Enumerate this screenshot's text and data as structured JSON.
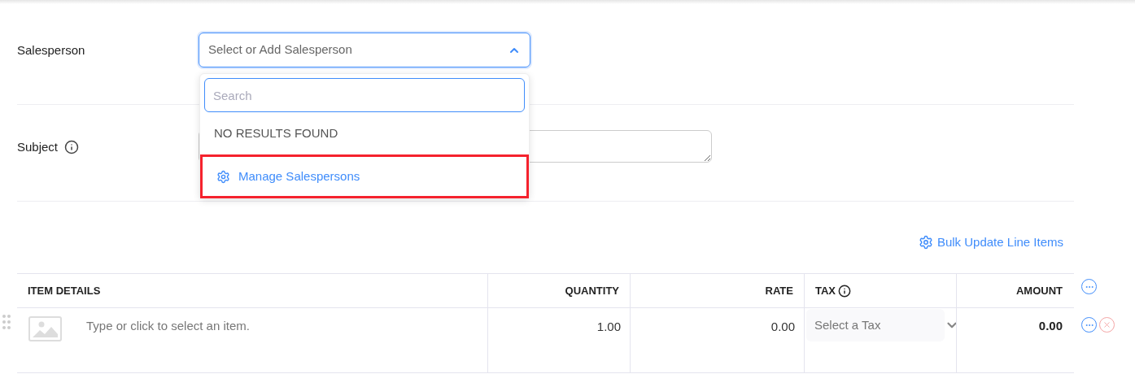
{
  "salesperson": {
    "label": "Salesperson",
    "placeholder": "Select or Add Salesperson",
    "expanded": true,
    "dropdown": {
      "search_placeholder": "Search",
      "empty_message": "NO RESULTS FOUND",
      "manage_link": {
        "label": "Manage Salespersons",
        "highlighted": true
      }
    }
  },
  "subject": {
    "label": "Subject"
  },
  "bulk_update": {
    "label": "Bulk Update Line Items"
  },
  "table": {
    "columns": [
      {
        "label": "ITEM DETAILS",
        "info": false
      },
      {
        "label": "QUANTITY",
        "info": false
      },
      {
        "label": "RATE",
        "info": false
      },
      {
        "label": "TAX",
        "info": true
      },
      {
        "label": "AMOUNT",
        "info": false
      }
    ],
    "rows": [
      {
        "item_placeholder": "Type or click to select an item.",
        "quantity": "1.00",
        "rate": "0.00",
        "tax_placeholder": "Select a Tax",
        "amount": "0.00"
      }
    ]
  }
}
